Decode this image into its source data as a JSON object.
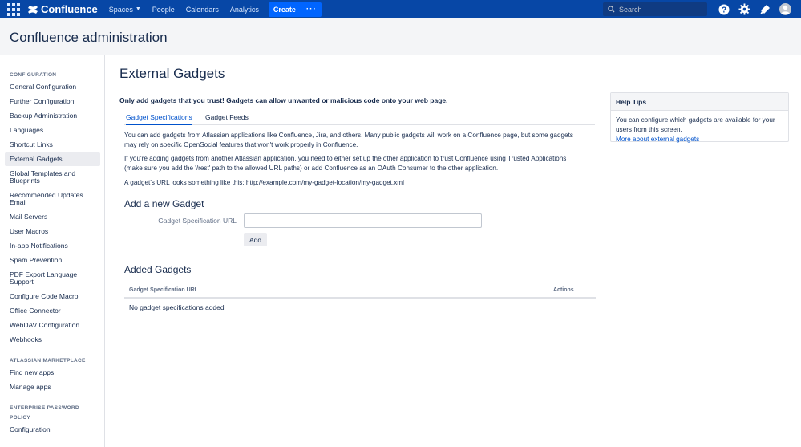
{
  "topnav": {
    "logo_text": "Confluence",
    "items": [
      "Spaces",
      "People",
      "Calendars",
      "Analytics"
    ],
    "create_label": "Create",
    "more_label": "···",
    "search_placeholder": "Search",
    "brand_color": "#0747a6"
  },
  "header": {
    "title": "Confluence administration"
  },
  "sidebar": {
    "configuration_heading": "CONFIGURATION",
    "configuration_items": [
      "General Configuration",
      "Further Configuration",
      "Backup Administration",
      "Languages",
      "Shortcut Links",
      "External Gadgets",
      "Global Templates and Blueprints",
      "Recommended Updates Email",
      "Mail Servers",
      "User Macros",
      "In-app Notifications",
      "Spam Prevention",
      "PDF Export Language Support",
      "Configure Code Macro",
      "Office Connector",
      "WebDAV Configuration",
      "Webhooks"
    ],
    "active_item": "External Gadgets",
    "marketplace_heading": "ATLASSIAN MARKETPLACE",
    "marketplace_items": [
      "Find new apps",
      "Manage apps"
    ],
    "password_heading": "ENTERPRISE PASSWORD POLICY",
    "password_items": [
      "Configuration"
    ]
  },
  "main": {
    "title": "External Gadgets",
    "warning": "Only add gadgets that you trust! Gadgets can allow unwanted or malicious code onto your web page.",
    "tabs": [
      "Gadget Specifications",
      "Gadget Feeds"
    ],
    "active_tab": "Gadget Specifications",
    "paragraphs": [
      "You can add gadgets from Atlassian applications like Confluence, Jira, and others. Many public gadgets will work on a Confluence page, but some gadgets may rely on specific OpenSocial features that won't work properly in Confluence.",
      "If you're adding gadgets from another Atlassian application, you need to either set up the other application to trust Confluence using Trusted Applications (make sure you add the '/rest' path to the allowed URL paths) or add Confluence as an OAuth Consumer to the other application.",
      "A gadget's URL looks something like this: http://example.com/my-gadget-location/my-gadget.xml"
    ],
    "add_heading": "Add a new Gadget",
    "form_label": "Gadget Specification URL",
    "form_value": "",
    "add_button": "Add",
    "added_heading": "Added Gadgets",
    "table_headers": [
      "Gadget Specification URL",
      "Actions"
    ],
    "table_empty": "No gadget specifications added"
  },
  "help": {
    "title": "Help Tips",
    "text": "You can configure which gadgets are available for your users from this screen.",
    "link": "More about external gadgets"
  }
}
